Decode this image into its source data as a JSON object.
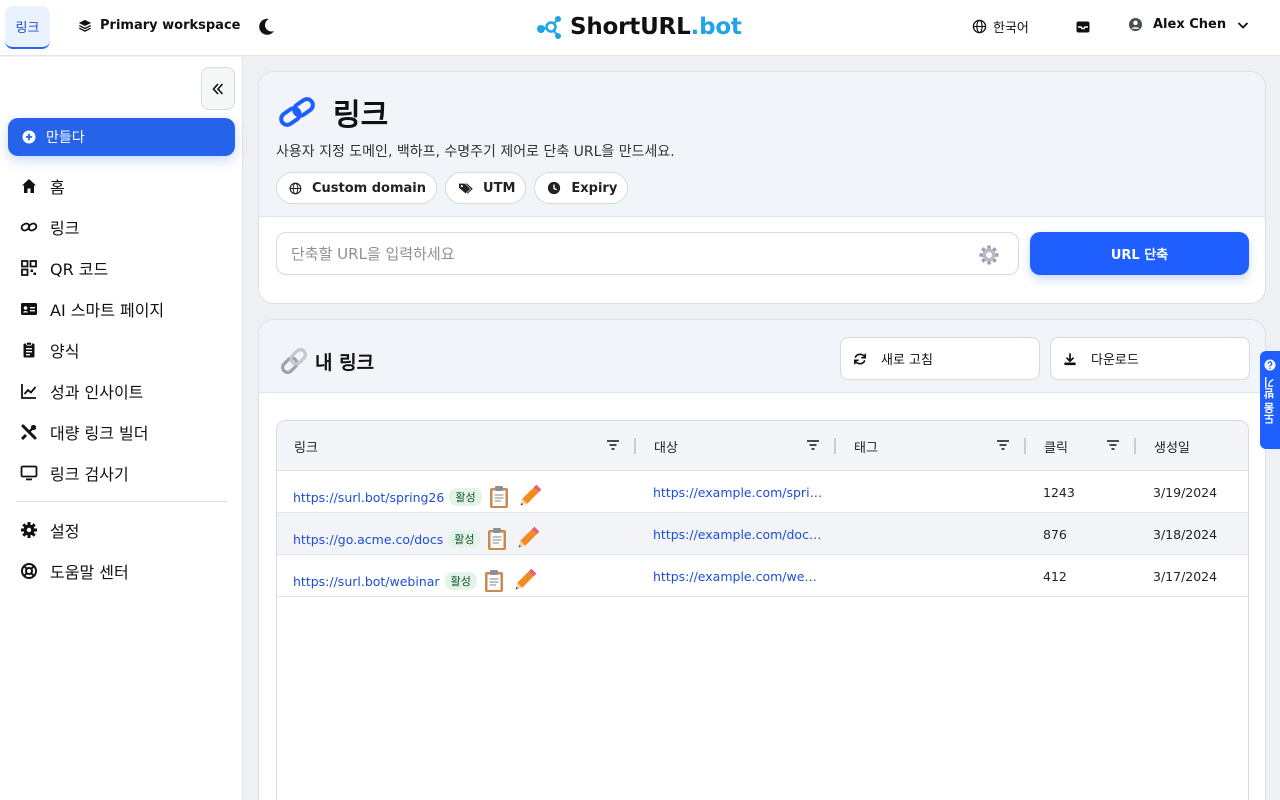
{
  "topbar": {
    "active_tab": "링크",
    "workspace": "Primary workspace",
    "brand_main": "ShortURL",
    "brand_accent": ".bot",
    "language": "한국어",
    "user_name": "Alex Chen"
  },
  "sidebar": {
    "create_label": "만들다",
    "items": [
      {
        "label": "홈",
        "icon": "home-icon"
      },
      {
        "label": "링크",
        "icon": "link-icon"
      },
      {
        "label": "QR 코드",
        "icon": "qr-icon"
      },
      {
        "label": "AI 스마트 페이지",
        "icon": "id-card-icon"
      },
      {
        "label": "양식",
        "icon": "clipboard-icon"
      },
      {
        "label": "성과 인사이트",
        "icon": "chart-icon"
      },
      {
        "label": "대량 링크 빌더",
        "icon": "tools-icon"
      },
      {
        "label": "링크 검사기",
        "icon": "monitor-icon"
      }
    ],
    "bottom_items": [
      {
        "label": "설정",
        "icon": "gear-icon"
      },
      {
        "label": "도움말 센터",
        "icon": "lifebuoy-icon"
      }
    ]
  },
  "create": {
    "title": "링크",
    "subtitle": "사용자 지정 도메인, 백하프, 수명주기 제어로 단축 URL을 만드세요.",
    "chips": [
      "Custom domain",
      "UTM",
      "Expiry"
    ],
    "input_placeholder": "단축할 URL을 입력하세요",
    "shorten_label": "URL 단축"
  },
  "links": {
    "title": "내 링크",
    "refresh_label": "새로 고침",
    "download_label": "다운로드",
    "columns": [
      "링크",
      "대상",
      "태그",
      "클릭",
      "생성일"
    ],
    "rows": [
      {
        "link": "https://surl.bot/spring26",
        "status": "활성",
        "target": "https://example.com/spring-campaign",
        "tags": "",
        "clicks": "1243",
        "created": "3/19/2024"
      },
      {
        "link": "https://go.acme.co/docs",
        "status": "활성",
        "target": "https://example.com/docs/getting-started",
        "tags": "",
        "clicks": "876",
        "created": "3/18/2024"
      },
      {
        "link": "https://surl.bot/webinar",
        "status": "활성",
        "target": "https://example.com/webinar-registration",
        "tags": "",
        "clicks": "412",
        "created": "3/17/2024"
      }
    ]
  },
  "help_tab": "도움 받기",
  "colors": {
    "accent": "#1f5eff",
    "brand_accent": "#1fa4e8",
    "status_bg": "#e3f4e8"
  }
}
